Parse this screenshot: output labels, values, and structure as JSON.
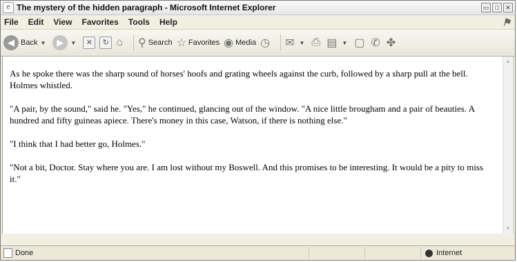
{
  "window": {
    "title": "The mystery of the hidden paragraph - Microsoft Internet Explorer",
    "buttons": [
      "▭",
      "□",
      "✕"
    ]
  },
  "menu": [
    "File",
    "Edit",
    "View",
    "Favorites",
    "Tools",
    "Help"
  ],
  "toolbar": {
    "back": "Back",
    "search": "Search",
    "favorites": "Favorites",
    "media": "Media"
  },
  "content": {
    "paragraphs": [
      "As he spoke there was the sharp sound of horses' hoofs and grating wheels against the curb, followed by a sharp pull at the bell. Holmes whistled.",
      "\"A pair, by the sound,\" said he. \"Yes,\" he continued, glancing out of the window. \"A nice little brougham and a pair of beauties. A hundred and fifty guineas apiece. There's money in this case, Watson, if there is nothing else.\"",
      "\"I think that I had better go, Holmes.\"",
      "\"Not a bit, Doctor. Stay where you are. I am lost without my Boswell. And this promises to be interesting. It would be a pity to miss it.\""
    ]
  },
  "status": {
    "text": "Done",
    "zone": "Internet"
  }
}
